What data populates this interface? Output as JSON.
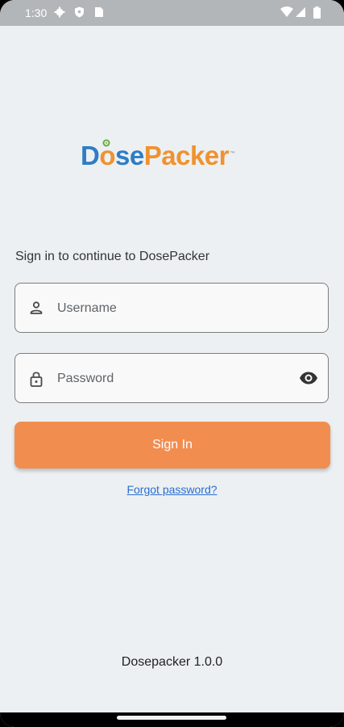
{
  "status_bar": {
    "time": "1:30",
    "icons": [
      "gear-icon",
      "shield-icon",
      "sim-icon",
      "wifi-icon",
      "signal-icon",
      "battery-icon"
    ]
  },
  "logo": {
    "part1": "D",
    "part2": "o",
    "part3": "se",
    "part4": "Packer",
    "tm": "™",
    "colors": {
      "blue": "#2f7dc4",
      "orange": "#f0922f"
    }
  },
  "login": {
    "subtitle": "Sign in to continue to DosePacker",
    "username_placeholder": "Username",
    "password_placeholder": "Password",
    "signin_label": "Sign In",
    "forgot_label": "Forgot password?"
  },
  "footer": {
    "version": "Dosepacker 1.0.0"
  },
  "colors": {
    "background": "#ecf0f3",
    "accent": "#f28d50",
    "link": "#2b6dcf"
  }
}
